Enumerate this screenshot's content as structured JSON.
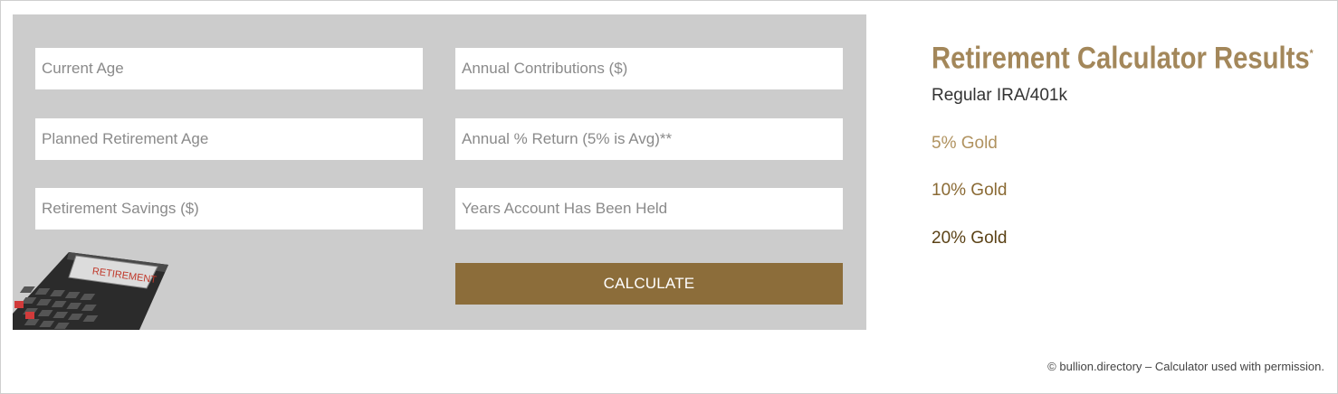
{
  "calculator": {
    "fields": {
      "current_age": {
        "placeholder": "Current Age",
        "value": ""
      },
      "annual_contributions": {
        "placeholder": "Annual Contributions ($)",
        "value": ""
      },
      "planned_retirement_age": {
        "placeholder": "Planned Retirement Age",
        "value": ""
      },
      "annual_return": {
        "placeholder": "Annual % Return (5% is Avg)**",
        "value": ""
      },
      "retirement_savings": {
        "placeholder": "Retirement Savings ($)",
        "value": ""
      },
      "years_held": {
        "placeholder": "Years Account Has Been Held",
        "value": ""
      }
    },
    "calculate_label": "CALCULATE",
    "illustration_text": "RETIREMENT"
  },
  "results": {
    "title": "Retirement Calculator Results",
    "title_mark": "*",
    "regular": "Regular IRA/401k",
    "gold5": "5% Gold",
    "gold10": "10% Gold",
    "gold20": "20% Gold"
  },
  "footer": {
    "note": "© bullion.directory – Calculator used with permission."
  },
  "colors": {
    "panel_bg": "#cccccc",
    "button_bg": "#8c6d3a",
    "title_gold": "#a3875a"
  }
}
